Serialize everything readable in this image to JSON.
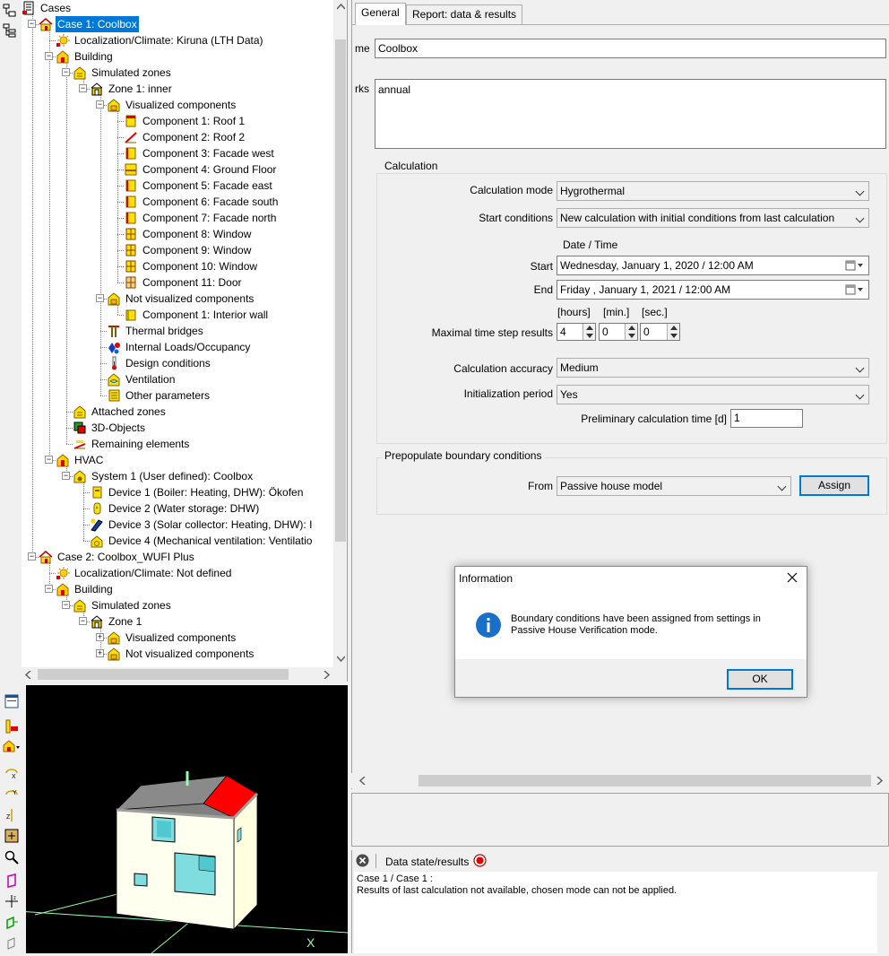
{
  "tree": {
    "nodes": [
      {
        "label": "Cases",
        "icon": "cases-root-icon",
        "level": 0,
        "expander": "minus"
      },
      {
        "label": "Case 1: Coolbox",
        "icon": "case-house-icon",
        "level": 1,
        "expander": "minus",
        "selected": true
      },
      {
        "label": "Localization/Climate: Kiruna (LTH Data)",
        "icon": "climate-sun-icon",
        "level": 2
      },
      {
        "label": "Building",
        "icon": "building-icon",
        "level": 2,
        "expander": "minus"
      },
      {
        "label": "Simulated zones",
        "icon": "zones-icon",
        "level": 3,
        "expander": "minus"
      },
      {
        "label": "Zone 1: inner",
        "icon": "zone-icon",
        "level": 4,
        "expander": "minus"
      },
      {
        "label": "Visualized components",
        "icon": "components-icon",
        "level": 5,
        "expander": "minus"
      },
      {
        "label": "Component 1: Roof 1",
        "icon": "roof-component-icon",
        "level": 6
      },
      {
        "label": "Component 2: Roof 2",
        "icon": "roof-slope-icon",
        "level": 6
      },
      {
        "label": "Component 3: Facade  west",
        "icon": "facade-component-icon",
        "level": 6
      },
      {
        "label": "Component 4: Ground Floor",
        "icon": "floor-component-icon",
        "level": 6
      },
      {
        "label": "Component 5: Facade east",
        "icon": "facade-component-icon",
        "level": 6
      },
      {
        "label": "Component 6: Facade south",
        "icon": "facade-component-icon",
        "level": 6
      },
      {
        "label": "Component 7: Facade  north",
        "icon": "facade-component-icon",
        "level": 6
      },
      {
        "label": "Component 8: Window",
        "icon": "window-component-icon",
        "level": 6
      },
      {
        "label": "Component 9: Window",
        "icon": "window-component-icon",
        "level": 6
      },
      {
        "label": "Component 10: Window",
        "icon": "window-component-icon",
        "level": 6
      },
      {
        "label": "Component 11: Door",
        "icon": "door-component-icon",
        "level": 6
      },
      {
        "label": "Not visualized components",
        "icon": "components-icon",
        "level": 5,
        "expander": "minus"
      },
      {
        "label": "Component 1: Interior wall",
        "icon": "interior-wall-icon",
        "level": 6
      },
      {
        "label": "Thermal bridges",
        "icon": "thermal-bridge-icon",
        "level": 5
      },
      {
        "label": "Internal Loads/Occupancy",
        "icon": "internal-loads-icon",
        "level": 5
      },
      {
        "label": "Design conditions",
        "icon": "thermometer-icon",
        "level": 5
      },
      {
        "label": "Ventilation",
        "icon": "ventilation-icon",
        "level": 5
      },
      {
        "label": "Other parameters",
        "icon": "parameters-icon",
        "level": 5
      },
      {
        "label": "Attached zones",
        "icon": "zones-icon",
        "level": 3
      },
      {
        "label": "3D-Objects",
        "icon": "objects-3d-icon",
        "level": 3
      },
      {
        "label": "Remaining elements",
        "icon": "remaining-elements-icon",
        "level": 3
      },
      {
        "label": "HVAC",
        "icon": "hvac-icon",
        "level": 2,
        "expander": "minus"
      },
      {
        "label": "System 1 (User defined): Coolbox",
        "icon": "system-icon",
        "level": 3,
        "expander": "minus"
      },
      {
        "label": "Device 1 (Boiler: Heating, DHW): Ökofen",
        "icon": "boiler-icon",
        "level": 4
      },
      {
        "label": "Device 2 (Water storage: DHW)",
        "icon": "water-storage-icon",
        "level": 4
      },
      {
        "label": "Device 3 (Solar collector: Heating, DHW): I",
        "icon": "solar-collector-icon",
        "level": 4
      },
      {
        "label": "Device 4 (Mechanical ventilation: Ventilatio",
        "icon": "mech-ventilation-icon",
        "level": 4
      },
      {
        "label": "Case 2: Coolbox_WUFI Plus",
        "icon": "case-house-icon",
        "level": 1,
        "expander": "minus"
      },
      {
        "label": "Localization/Climate: Not defined",
        "icon": "climate-sun-icon",
        "level": 2
      },
      {
        "label": "Building",
        "icon": "building-icon",
        "level": 2,
        "expander": "minus"
      },
      {
        "label": "Simulated zones",
        "icon": "zones-icon",
        "level": 3,
        "expander": "minus"
      },
      {
        "label": "Zone 1",
        "icon": "zone-icon",
        "level": 4,
        "expander": "minus"
      },
      {
        "label": "Visualized components",
        "icon": "components-icon",
        "level": 5,
        "expander": "plus"
      },
      {
        "label": "Not visualized components",
        "icon": "components-icon",
        "level": 5,
        "expander": "plus"
      }
    ]
  },
  "view3d": {
    "axis_label": "X"
  },
  "tabs": [
    {
      "label": "General",
      "active": true
    },
    {
      "label": "Report: data & results",
      "active": false
    }
  ],
  "general": {
    "name_label": "me",
    "name_value": "Coolbox",
    "remarks_label": "rks",
    "remarks_value": "annual"
  },
  "calculation": {
    "title": "Calculation",
    "mode_label": "Calculation mode",
    "mode_value": "Hygrothermal",
    "start_cond_label": "Start conditions",
    "start_cond_value": "New calculation with initial conditions from last calculation",
    "datetime_header": "Date / Time",
    "start_label": "Start",
    "start_value": "Wednesday,   January     1, 2020  /  12:00 AM",
    "end_label": "End",
    "end_value": "    Friday     ,   January     1, 2021  /  12:00 AM",
    "hours_header": "[hours]",
    "min_header": "[min.]",
    "sec_header": "[sec.]",
    "timestep_label": "Maximal time step results",
    "timestep_hours": "4",
    "timestep_min": "0",
    "timestep_sec": "0",
    "accuracy_label": "Calculation accuracy",
    "accuracy_value": "Medium",
    "init_label": "Initialization period",
    "init_value": "Yes",
    "prelim_label": "Preliminary calculation time  [d]",
    "prelim_value": "1"
  },
  "prepopulate": {
    "title": "Prepopulate boundary conditions",
    "from_label": "From",
    "from_value": "Passive house model",
    "assign_label": "Assign"
  },
  "status": {
    "title": "Data state/results",
    "line1": "Case 1 / Case 1 :",
    "line2": "Results of last calculation not available, chosen mode can not be applied."
  },
  "dialog": {
    "title": "Information",
    "message_line1": "Boundary conditions have been assigned from settings in",
    "message_line2": "Passive House Verification mode.",
    "ok_label": "OK"
  },
  "colors": {
    "selection": "#0078d7",
    "roof_red": "#ff0000",
    "wall_cream": "#ffffe0",
    "window_cyan": "#7fdde0",
    "info_blue": "#1a6fc9"
  }
}
